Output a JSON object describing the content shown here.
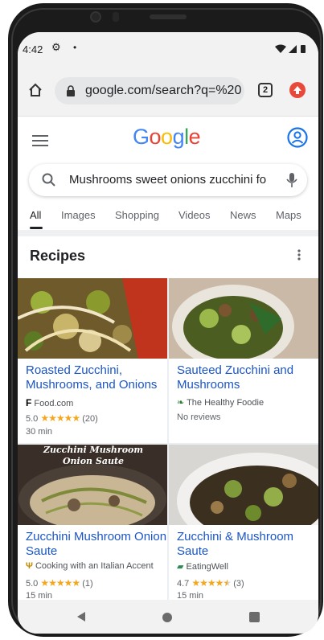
{
  "status_bar": {
    "time": "4:42"
  },
  "browser": {
    "url": "google.com/search?q=%20",
    "tab_count": "2"
  },
  "google": {
    "logo_letters": [
      "G",
      "o",
      "o",
      "g",
      "l",
      "e"
    ],
    "logo_colors": [
      "#4285F4",
      "#EA4335",
      "#FBBC05",
      "#4285F4",
      "#34A853",
      "#EA4335"
    ],
    "query": "Mushrooms sweet onions zucchini fo",
    "tabs": [
      "All",
      "Images",
      "Shopping",
      "Videos",
      "News",
      "Maps"
    ],
    "active_tab": "All"
  },
  "recipes": {
    "heading": "Recipes",
    "cards": [
      {
        "title": "Roasted Zucchini, Mushrooms, and Onions",
        "source": "Food.com",
        "rating": "5.0",
        "stars": "★★★★★",
        "count": "(20)",
        "time": "30 min"
      },
      {
        "title": "Sauteed Zucchini and Mushrooms",
        "source": "The Healthy Foodie",
        "reviews": "No reviews"
      },
      {
        "title": "Zucchini Mushroom Onion Saute",
        "source": "Cooking with an Italian Accent",
        "rating": "5.0",
        "stars": "★★★★★",
        "count": "(1)",
        "time": "15 min",
        "image_caption": "Zucchini Mushroom Onion Saute"
      },
      {
        "title": "Zucchini & Mushroom Saute",
        "source": "EatingWell",
        "rating": "4.7",
        "stars": "★★★★",
        "half_star": "★",
        "count": "(3)",
        "time": "15 min"
      }
    ]
  },
  "colors": {
    "link": "#1a55c8",
    "star": "#f4a71d",
    "update_badge": "#e8493a"
  }
}
